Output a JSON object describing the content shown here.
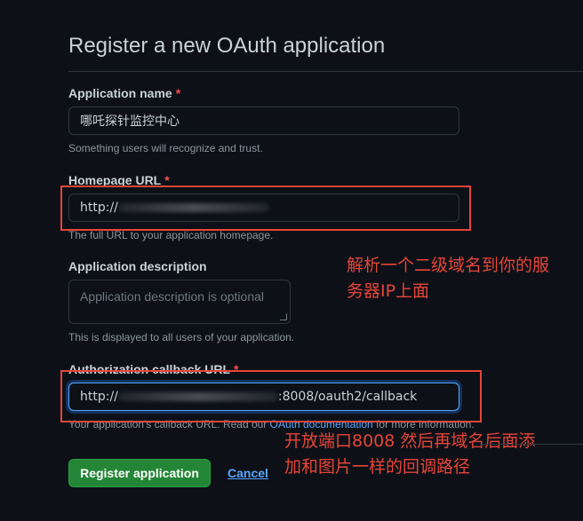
{
  "page": {
    "title": "Register a new OAuth application"
  },
  "fields": {
    "app_name": {
      "label": "Application name",
      "required_mark": "*",
      "value": "哪吒探针监控中心",
      "hint": "Something users will recognize and trust."
    },
    "homepage_url": {
      "label": "Homepage URL",
      "required_mark": "*",
      "value_prefix": "http://",
      "hint": "The full URL to your application homepage."
    },
    "description": {
      "label": "Application description",
      "placeholder": "Application description is optional",
      "hint": "This is displayed to all users of your application."
    },
    "callback_url": {
      "label": "Authorization callback URL",
      "required_mark": "*",
      "value_prefix": "http://",
      "value_suffix": ":8008/oauth2/callback",
      "hint_before": "Your application's callback URL. Read our",
      "hint_link": "OAuth documentation",
      "hint_after": "for more information."
    }
  },
  "annotations": {
    "note1_line1": "解析一个二级域名到你的服",
    "note1_line2": "务器IP上面",
    "note2_line1": "开放端口8008  然后再域名后面添",
    "note2_line2": "加和图片一样的回调路径",
    "color": "#e5453a"
  },
  "actions": {
    "register_label": "Register application",
    "cancel_label": "Cancel"
  },
  "colors": {
    "background": "#0d1117",
    "accent": "#58a6ff",
    "primary_button": "#238636",
    "required": "#f85149"
  }
}
